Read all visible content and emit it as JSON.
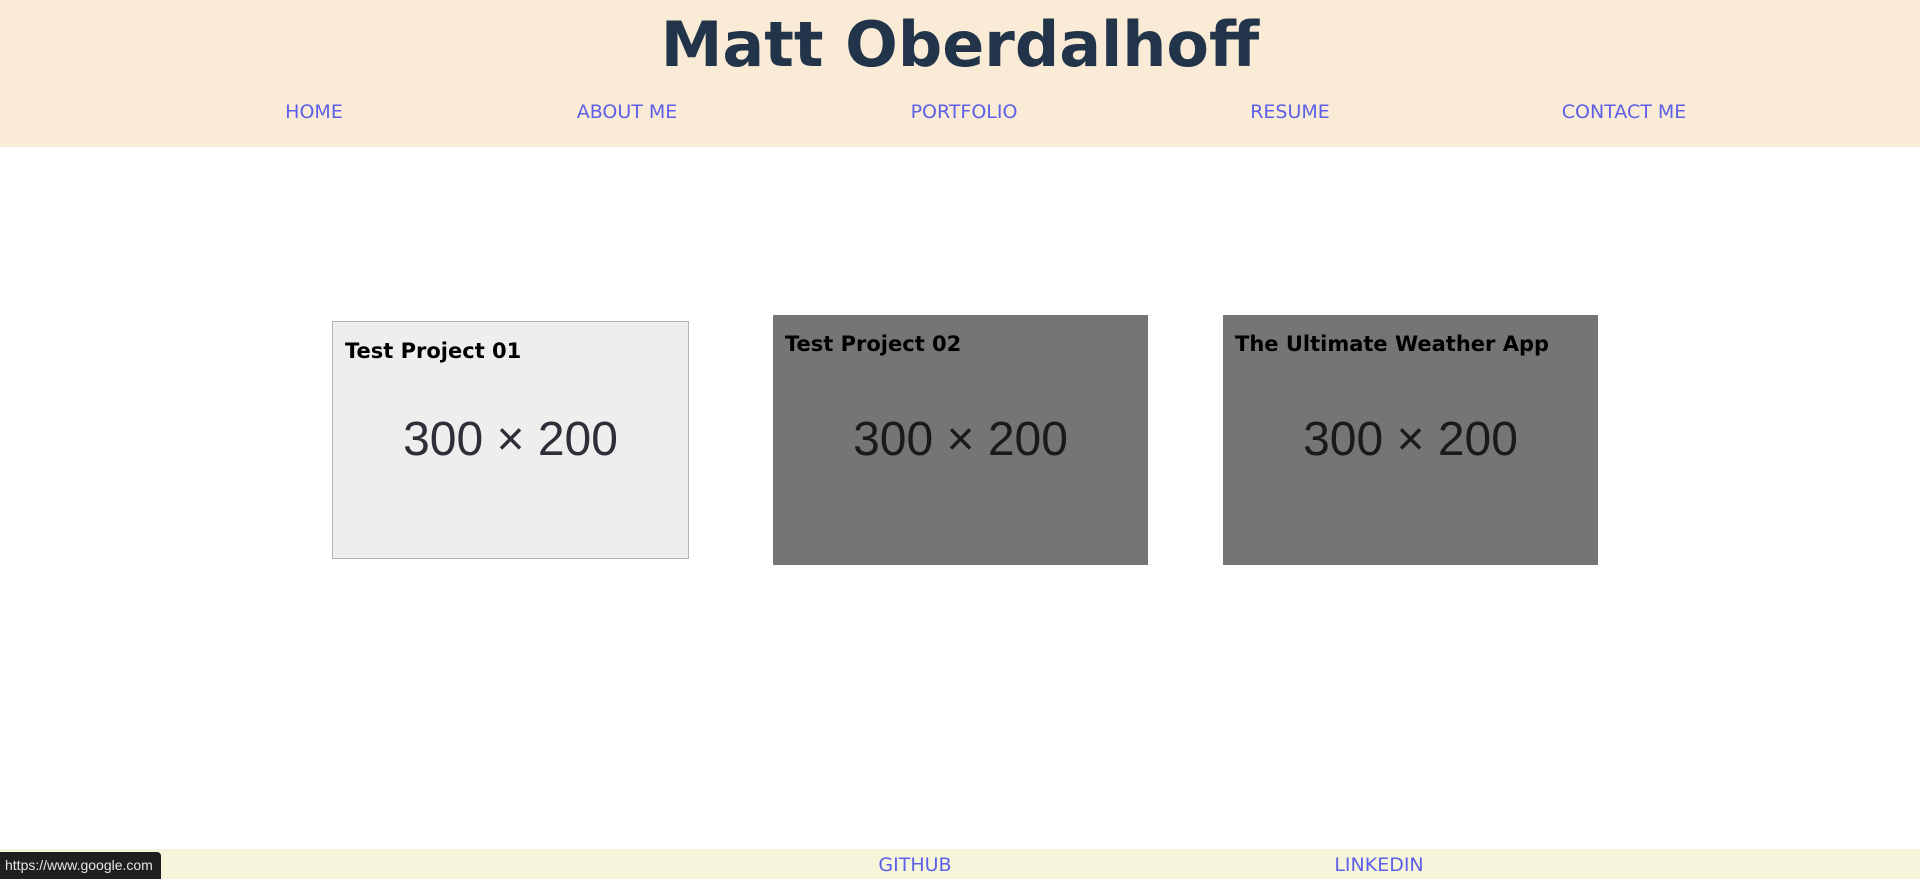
{
  "header": {
    "title": "Matt Oberdalhoff",
    "nav": [
      {
        "label": "HOME"
      },
      {
        "label": "ABOUT ME"
      },
      {
        "label": "PORTFOLIO"
      },
      {
        "label": "RESUME"
      },
      {
        "label": "CONTACT ME"
      }
    ]
  },
  "projects": [
    {
      "title": "Test Project 01",
      "image_text": "300 × 200"
    },
    {
      "title": "Test Project 02",
      "image_text": "300 × 200"
    },
    {
      "title": "The Ultimate Weather App",
      "image_text": "300 × 200"
    }
  ],
  "footer": {
    "links": [
      {
        "label": "GITHUB"
      },
      {
        "label": "LINKEDIN"
      }
    ]
  },
  "status_bar": {
    "url": "https://www.google.com"
  },
  "colors": {
    "header_bg": "#faebd7",
    "title": "#22344a",
    "link": "#5d5fe8",
    "footer_bg": "#f5f5dc",
    "card_light": "#eeeeee",
    "card_dark": "#757575"
  }
}
